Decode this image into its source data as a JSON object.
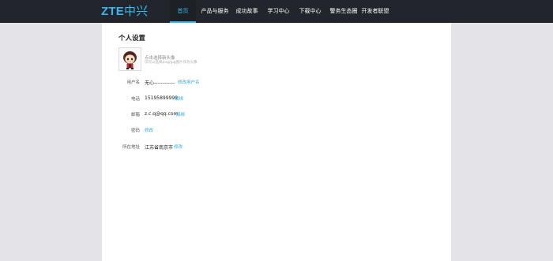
{
  "header": {
    "logo_latin": "ZTE",
    "logo_cn": "中兴",
    "accent_color": "#33b9f0",
    "nav": [
      {
        "label": "首页",
        "active": true
      },
      {
        "label": "产品与服务",
        "active": false
      },
      {
        "label": "成功故事",
        "active": false
      },
      {
        "label": "学习中心",
        "active": false
      },
      {
        "label": "下载中心",
        "active": false
      },
      {
        "label": "警务生态圈",
        "active": false
      },
      {
        "label": "开发者联盟",
        "active": false
      }
    ]
  },
  "profile": {
    "title": "个人设置",
    "avatar_hint": "点击选择新头像",
    "avatar_sub": "仅可以选择png/jpg图片作为头像",
    "rows": [
      {
        "label": "用户名",
        "value": "无心------------",
        "action": "修改用户名"
      },
      {
        "label": "电话",
        "value": "15195899999",
        "action": "解绑"
      },
      {
        "label": "邮箱",
        "value": "z.c.q@qq.com",
        "action": "解绑"
      },
      {
        "label": "密码",
        "value": "",
        "action": "修改"
      },
      {
        "label": "所在地址",
        "value": "江苏省南京市",
        "action": "修改"
      }
    ]
  }
}
